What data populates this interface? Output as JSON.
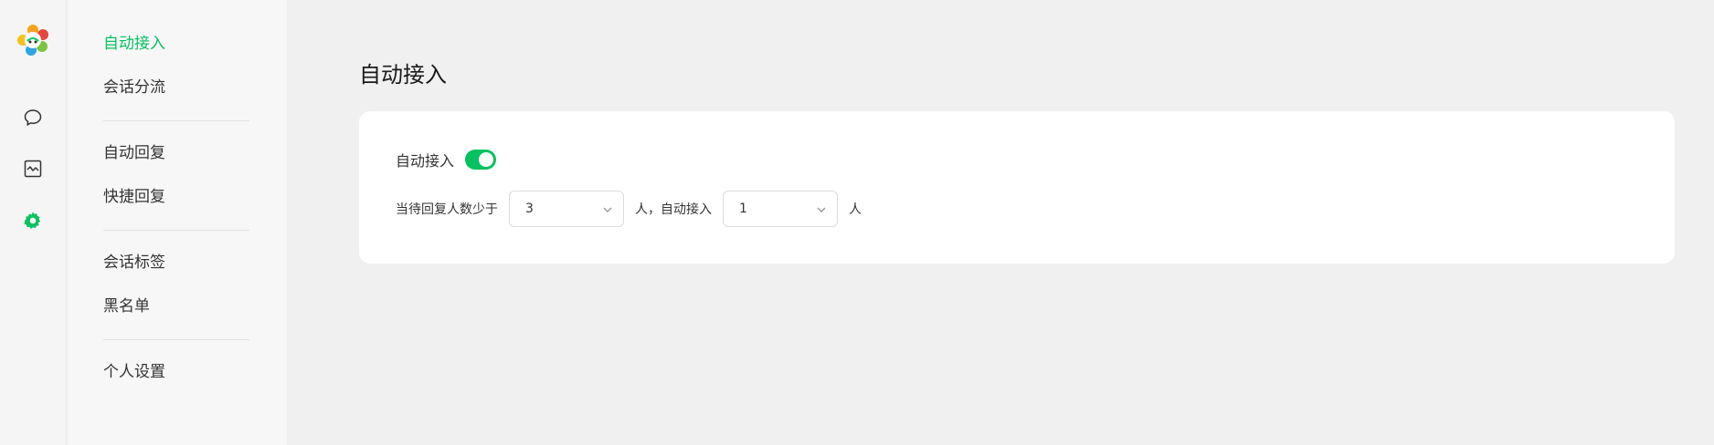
{
  "rail": {
    "logo_icon": "colorful-flower-logo",
    "buttons": [
      {
        "icon": "chat-bubble-icon",
        "active": false
      },
      {
        "icon": "chart-window-icon",
        "active": false
      },
      {
        "icon": "gear-icon",
        "active": true
      }
    ]
  },
  "menu": {
    "auto_access": "自动接入",
    "session_dispatch": "会话分流",
    "auto_reply": "自动回复",
    "quick_reply": "快捷回复",
    "session_tags": "会话标签",
    "blacklist": "黑名单",
    "personal_settings": "个人设置"
  },
  "main": {
    "title": "自动接入",
    "toggle_label": "自动接入",
    "toggle_on": true,
    "rule_prefix": "当待回复人数少于",
    "threshold_value": "3",
    "rule_middle": "人，自动接入",
    "accept_value": "1",
    "rule_suffix": "人"
  },
  "colors": {
    "accent": "#07c160",
    "page_bg": "#f0f0f0",
    "card_bg": "#ffffff"
  }
}
